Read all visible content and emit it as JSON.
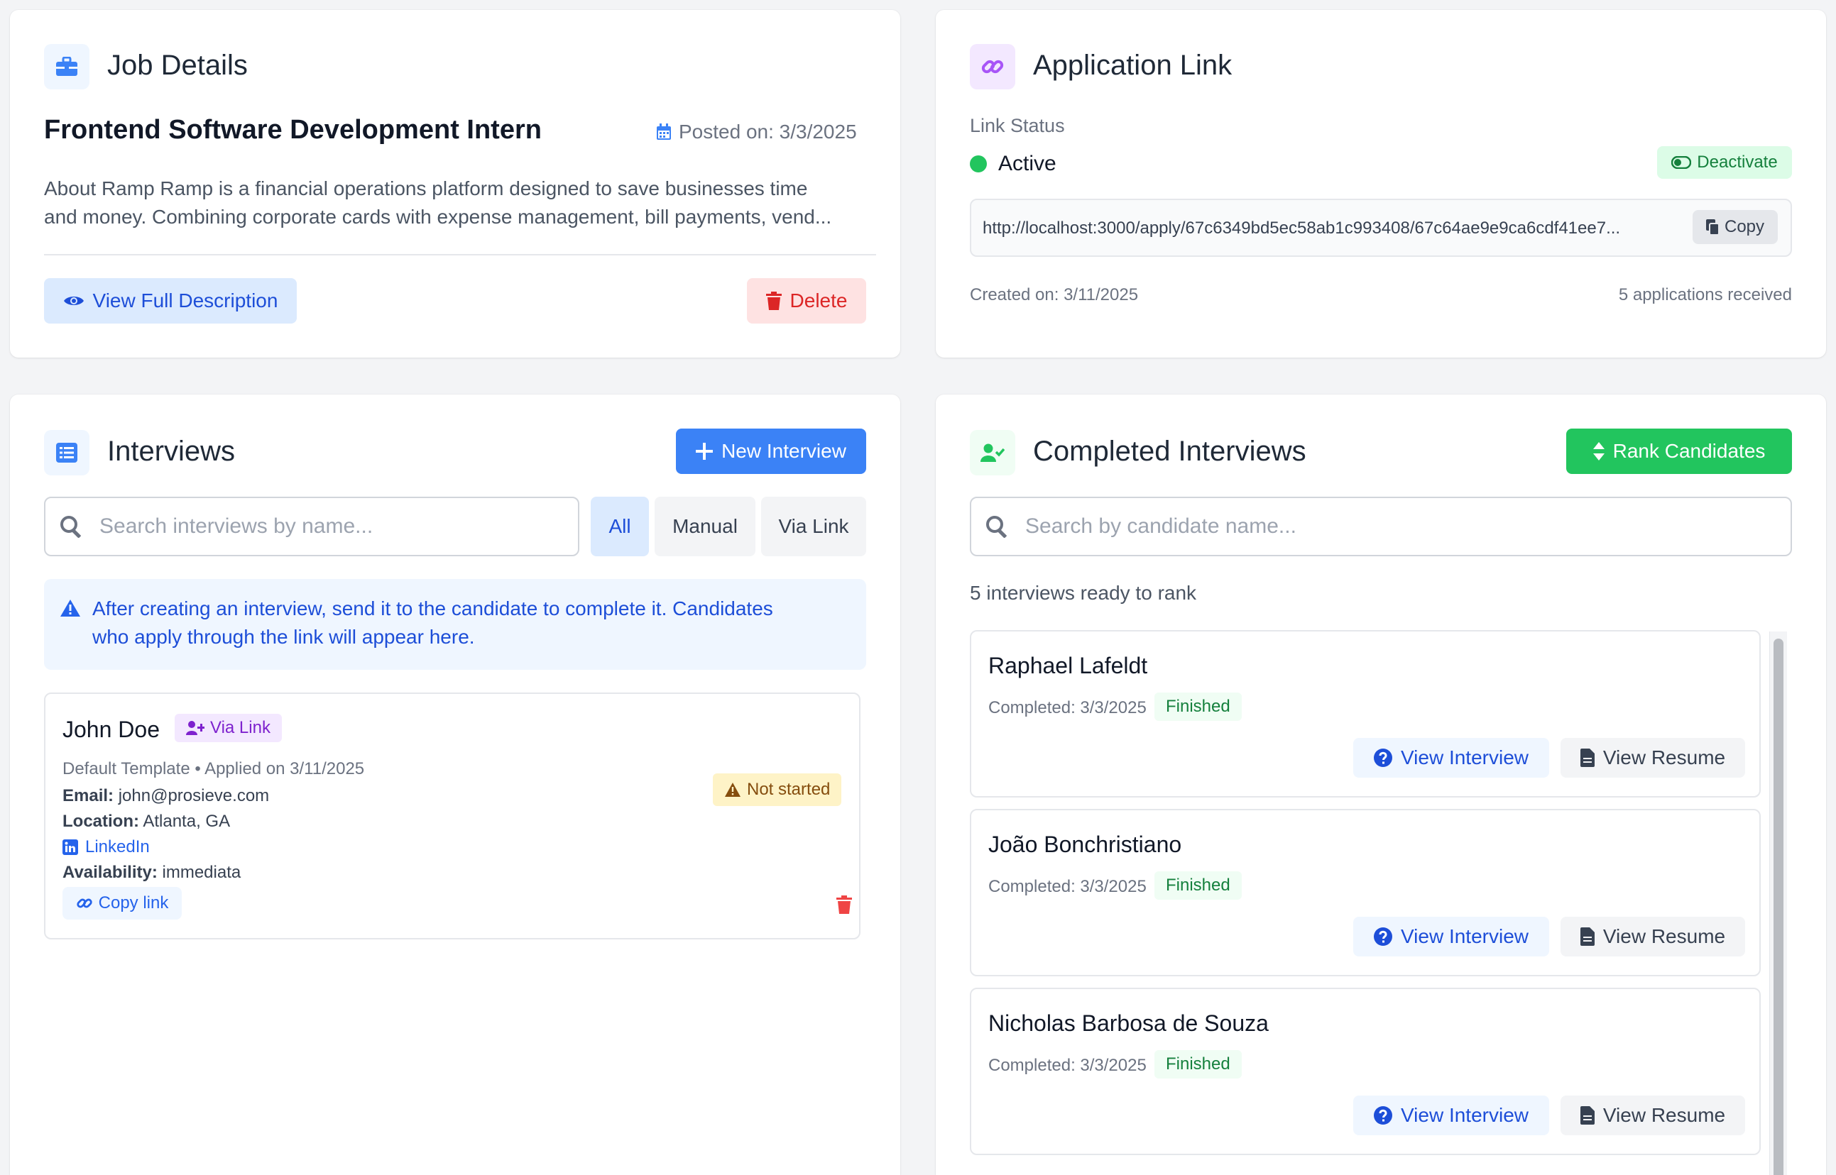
{
  "job_details": {
    "title": "Job Details",
    "job_title": "Frontend Software Development Intern",
    "posted_on": "Posted on: 3/3/2025",
    "description_line1": "About Ramp Ramp is a financial operations platform designed to save businesses time",
    "description_line2": "and money. Combining corporate cards with expense management, bill payments, vend...",
    "view_full_label": "View Full Description",
    "delete_label": "Delete"
  },
  "application_link": {
    "title": "Application Link",
    "status_label": "Link Status",
    "status": "Active",
    "deactivate_label": "Deactivate",
    "url": "http://localhost:3000/apply/67c6349bd5ec58ab1c993408/67c64ae9e9ca6cdf41ee7...",
    "copy_label": "Copy",
    "created_on": "Created on: 3/11/2025",
    "applications_received": "5 applications received"
  },
  "interviews": {
    "title": "Interviews",
    "new_interview_label": "New Interview",
    "search_placeholder": "Search interviews by name...",
    "filters": {
      "all": "All",
      "manual": "Manual",
      "via_link": "Via Link"
    },
    "notice_line1": "After creating an interview, send it to the candidate to complete it. Candidates",
    "notice_line2": "who apply through the link will appear here.",
    "candidate": {
      "name": "John Doe",
      "source_badge": "Via Link",
      "meta": "Default Template • Applied on 3/11/2025",
      "email_label": "Email:",
      "email": "john@prosieve.com",
      "location_label": "Location:",
      "location": "Atlanta, GA",
      "linkedin": "LinkedIn",
      "availability_label": "Availability:",
      "availability": "immediata",
      "status_badge": "Not started",
      "copy_link_label": "Copy link"
    }
  },
  "completed_interviews": {
    "title": "Completed Interviews",
    "rank_label": "Rank Candidates",
    "search_placeholder": "Search by candidate name...",
    "ready_count": "5 interviews ready to rank",
    "view_interview_label": "View Interview",
    "view_resume_label": "View Resume",
    "candidates": [
      {
        "name": "Raphael Lafeldt",
        "completed": "Completed: 3/3/2025",
        "status": "Finished"
      },
      {
        "name": "João Bonchristiano",
        "completed": "Completed: 3/3/2025",
        "status": "Finished"
      },
      {
        "name": "Nicholas Barbosa de Souza",
        "completed": "Completed: 3/3/2025",
        "status": "Finished"
      }
    ]
  },
  "colors": {
    "primary": "#3b82f6",
    "success": "#22c55e",
    "danger": "#dc2626",
    "warning_bg": "#fef3c7",
    "purple": "#7e22ce"
  }
}
